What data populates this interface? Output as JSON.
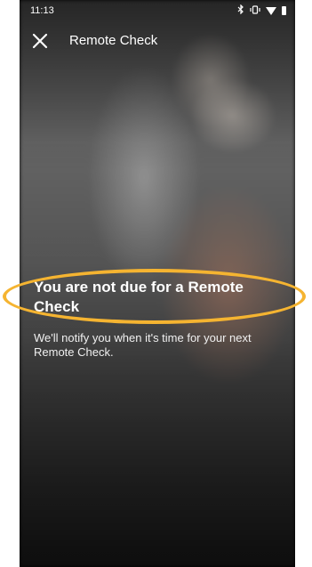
{
  "status_bar": {
    "time": "11:13",
    "icons": [
      "bluetooth-icon",
      "vibrate-icon",
      "wifi-icon",
      "battery-icon"
    ]
  },
  "app_bar": {
    "close_icon": "close-icon",
    "title": "Remote Check"
  },
  "main": {
    "headline": "You are not due for a Remote Check",
    "message": "We'll notify you when it's time for your next Remote Check."
  },
  "colors": {
    "highlight": "#f5b431",
    "text": "#ffffff"
  }
}
